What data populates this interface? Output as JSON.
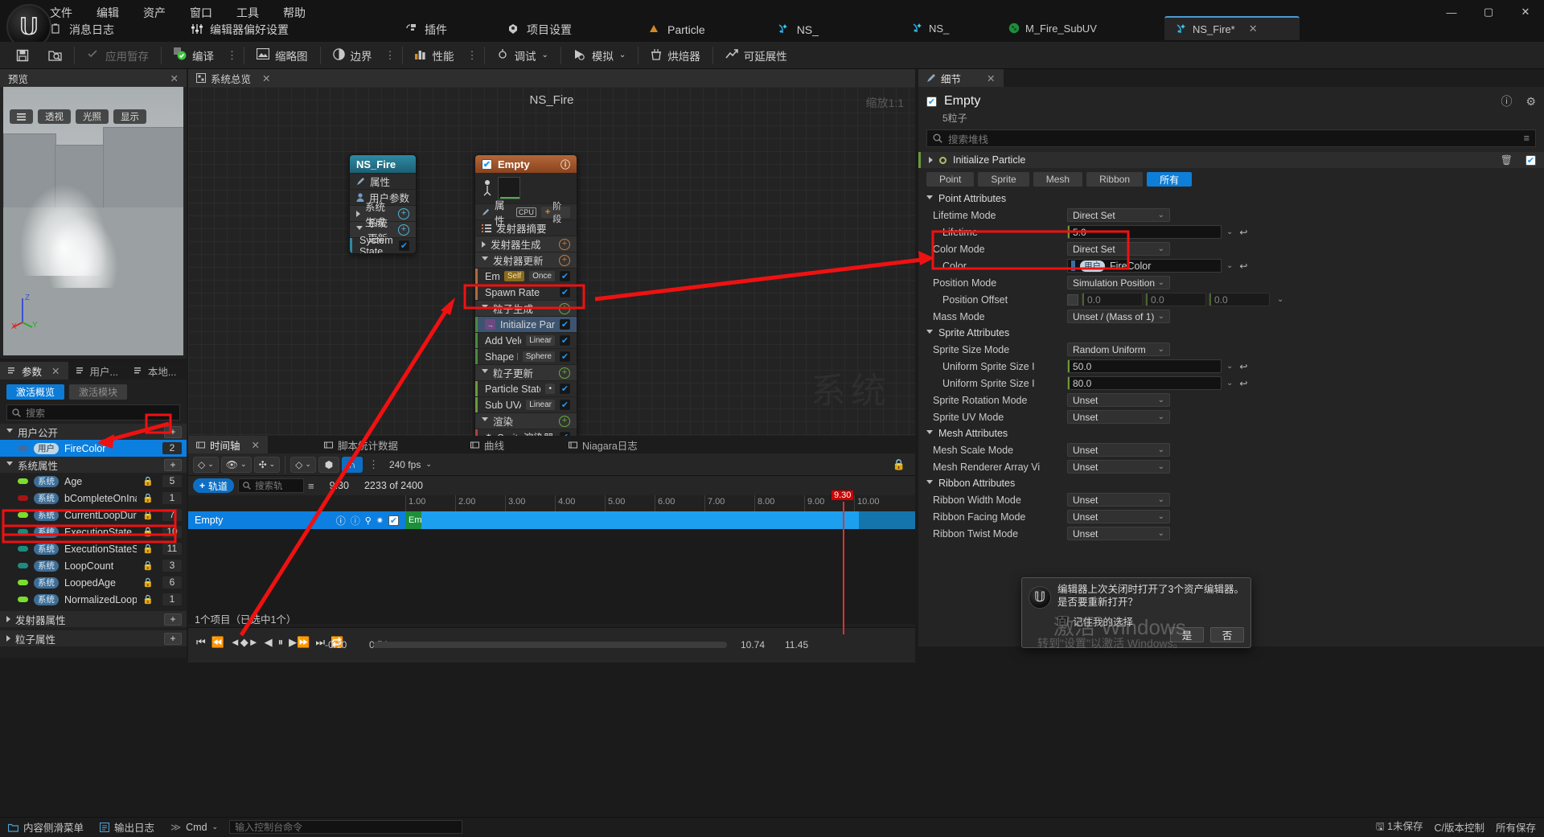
{
  "menu": {
    "items": [
      "文件",
      "编辑",
      "资产",
      "窗口",
      "工具",
      "帮助"
    ],
    "shortcuts": [
      {
        "label": "消息日志",
        "icon": "log-icon"
      },
      {
        "label": "编辑器偏好设置",
        "icon": "sliders-icon"
      },
      {
        "label": "插件",
        "icon": "plug-icon"
      },
      {
        "label": "项目设置",
        "icon": "settings-icon"
      },
      {
        "label": "Particle",
        "icon": "particle-icon"
      },
      {
        "label": "NS_",
        "icon": "niagara-icon"
      }
    ],
    "window_controls": {
      "minimize": "—",
      "maximize": "▢",
      "close": "✕"
    }
  },
  "tabs": [
    {
      "label": "NS_",
      "active": false,
      "icon": "niagara-icon"
    },
    {
      "label": "M_Fire_SubUV",
      "active": false,
      "icon": "material-icon"
    },
    {
      "label": "NS_Fire*",
      "active": true,
      "icon": "niagara-icon",
      "close": "✕"
    }
  ],
  "toolbar": {
    "save_icon": "save-icon",
    "browse_icon": "browse-icon",
    "items": [
      {
        "label": "应用暂存",
        "icon": "apply-icon",
        "dim": true
      },
      {
        "label": "编译",
        "icon": "compile-icon",
        "dim": false,
        "dots": true
      },
      {
        "label": "缩略图",
        "icon": "thumbnail-icon",
        "dim": false
      },
      {
        "label": "边界",
        "icon": "bounds-icon",
        "dim": false,
        "dots": true
      },
      {
        "label": "性能",
        "icon": "performance-icon",
        "dim": false,
        "dots": true
      },
      {
        "label": "调试",
        "icon": "debug-icon",
        "dim": false,
        "caret": "⌄"
      },
      {
        "label": "模拟",
        "icon": "simulate-icon",
        "dim": false,
        "caret": "⌄"
      },
      {
        "label": "烘焙器",
        "icon": "baker-icon",
        "dim": false
      },
      {
        "label": "可延展性",
        "icon": "scalability-icon",
        "dim": false
      }
    ]
  },
  "preview": {
    "tab_label": "预览",
    "close": "✕",
    "menu_icon": "hamburger-icon",
    "chips": [
      "透视",
      "光照",
      "显示"
    ],
    "axis": {
      "z": "Z",
      "x": "X",
      "y": "Y"
    }
  },
  "parameters": {
    "tabs": [
      {
        "label": "参数",
        "icon": "params-icon",
        "active": true,
        "close": "✕"
      },
      {
        "label": "用户...",
        "icon": "user-icon",
        "active": false
      },
      {
        "label": "本地...",
        "icon": "local-icon",
        "active": false
      }
    ],
    "buttons": [
      {
        "label": "激活概览",
        "active": true
      },
      {
        "label": "激活模块",
        "active": false
      }
    ],
    "search_placeholder": "搜索",
    "groups": [
      {
        "name": "用户公开",
        "add_label": "+",
        "rows": [
          {
            "tag": "用户",
            "tag_kind": "user",
            "name": "FireColor",
            "value": "2",
            "dot": "#3a6ea5",
            "locked": false,
            "selected": true
          }
        ]
      },
      {
        "name": "系统属性",
        "add_label": "+",
        "rows": [
          {
            "tag": "系统",
            "tag_kind": "system",
            "name": "Age",
            "value": "5",
            "dot": "#7ade2e",
            "locked": true,
            "selected": false
          },
          {
            "tag": "系统",
            "tag_kind": "system",
            "name": "bCompleteOnInacti",
            "value": "1",
            "dot": "#a81414",
            "locked": true,
            "selected": false
          },
          {
            "tag": "系统",
            "tag_kind": "system",
            "name": "CurrentLoopDuratic",
            "value": "7",
            "dot": "#7ade2e",
            "locked": true,
            "selected": false
          },
          {
            "tag": "系统",
            "tag_kind": "system",
            "name": "ExecutionState",
            "value": "10",
            "dot": "#1d8b7e",
            "locked": true,
            "selected": false
          },
          {
            "tag": "系统",
            "tag_kind": "system",
            "name": "ExecutionStateSou",
            "value": "11",
            "dot": "#1d8b7e",
            "locked": true,
            "selected": false
          },
          {
            "tag": "系统",
            "tag_kind": "system",
            "name": "LoopCount",
            "value": "3",
            "dot": "#1d8b7e",
            "locked": true,
            "selected": false
          },
          {
            "tag": "系统",
            "tag_kind": "system",
            "name": "LoopedAge",
            "value": "6",
            "dot": "#7ade2e",
            "locked": true,
            "selected": false
          },
          {
            "tag": "系统",
            "tag_kind": "system",
            "name": "NormalizedLoopAg",
            "value": "1",
            "dot": "#7ade2e",
            "locked": true,
            "selected": false
          }
        ]
      }
    ],
    "footers": [
      {
        "name": "发射器属性",
        "add_label": "+"
      },
      {
        "name": "粒子属性",
        "add_label": "+"
      }
    ]
  },
  "graph": {
    "tab_label": "系统总览",
    "close": "✕",
    "title": "NS_Fire",
    "zoom_label": "缩放1:1",
    "watermark": "系统",
    "system_node": {
      "title": "NS_Fire",
      "rows": [
        {
          "label": "属性",
          "icon": "properties-icon",
          "kind": "plain"
        },
        {
          "label": "用户参数",
          "icon": "user-icon",
          "kind": "plain"
        },
        {
          "label": "系统生成",
          "kind": "header",
          "add": "+"
        },
        {
          "label": "系统更新",
          "kind": "header",
          "add": "+",
          "expanded": true
        },
        {
          "label": "System State",
          "kind": "item",
          "checked": true
        }
      ]
    },
    "emitter_node": {
      "title": "Empty",
      "checked": true,
      "info_icon": "info-icon",
      "properties_label": "属性",
      "cpu_label": "CPU",
      "stage_label": "阶段",
      "summary_label": "发射器摘要",
      "rows": [
        {
          "label": "发射器生成",
          "kind": "header",
          "add": "+"
        },
        {
          "label": "发射器更新",
          "kind": "header",
          "add": "+",
          "expanded": true
        },
        {
          "label": "Emitter State",
          "kind": "item",
          "pills": [
            "Self",
            "Once"
          ],
          "checked": true
        },
        {
          "label": "Spawn Rate",
          "kind": "item",
          "checked": true
        },
        {
          "label": "粒子生成",
          "kind": "header",
          "add": "+",
          "expanded": true
        },
        {
          "label": "Initialize Particle",
          "kind": "item",
          "checked": true,
          "selected": true,
          "icon": "module-icon"
        },
        {
          "label": "Add Velocity",
          "kind": "item",
          "pills": [
            "Linear"
          ],
          "checked": true
        },
        {
          "label": "Shape Location",
          "kind": "item",
          "pills": [
            "Sphere"
          ],
          "checked": true
        },
        {
          "label": "粒子更新",
          "kind": "header",
          "add": "+",
          "expanded": true
        },
        {
          "label": "Particle State",
          "kind": "item",
          "pills": [
            "•"
          ],
          "checked": true
        },
        {
          "label": "Sub UVAnimation",
          "kind": "item",
          "pills": [
            "Linear"
          ],
          "checked": true
        },
        {
          "label": "渲染",
          "kind": "header",
          "add": "+",
          "expanded": true
        },
        {
          "label": "Sprite渲染器",
          "kind": "item",
          "checked": true,
          "icon": "sprite-icon"
        }
      ],
      "collapse": "⌃"
    }
  },
  "details": {
    "tab_label": "细节",
    "close": "✕",
    "object_name": "Empty",
    "object_checked": true,
    "particle_count": "5粒子",
    "info_icon": "info-icon",
    "gear_icon": "gear-icon",
    "search_placeholder": "搜索堆栈",
    "filter_icon": "filter-icon",
    "module": {
      "name": "Initialize Particle",
      "delete_icon": "trash-icon",
      "enabled": true,
      "modes": [
        {
          "label": "Point",
          "active": false
        },
        {
          "label": "Sprite",
          "active": false
        },
        {
          "label": "Mesh",
          "active": false
        },
        {
          "label": "Ribbon",
          "active": false
        },
        {
          "label": "所有",
          "active": true
        }
      ]
    },
    "sections": [
      {
        "title": "Point Attributes",
        "rows": [
          {
            "label": "Lifetime Mode",
            "type": "select",
            "value": "Direct Set",
            "indent": 0
          },
          {
            "label": "Lifetime",
            "type": "number",
            "value": "5.0",
            "indent": 1,
            "chevron": true,
            "revert": true
          },
          {
            "label": "Color Mode",
            "type": "select",
            "value": "Direct Set",
            "indent": 0
          },
          {
            "label": "Color",
            "type": "color",
            "value": "FireColor",
            "tag": "用户",
            "indent": 1,
            "chevron": true,
            "revert": true
          },
          {
            "label": "Position Mode",
            "type": "select",
            "value": "Simulation Position",
            "indent": 0
          },
          {
            "label": "Position Offset",
            "type": "vector3",
            "value": [
              "0.0",
              "0.0",
              "0.0"
            ],
            "indent": 1,
            "chevron": true,
            "disabled": true
          },
          {
            "label": "Mass Mode",
            "type": "select",
            "value": "Unset / (Mass of 1)",
            "indent": 0
          }
        ]
      },
      {
        "title": "Sprite Attributes",
        "rows": [
          {
            "label": "Sprite Size Mode",
            "type": "select",
            "value": "Random Uniform",
            "indent": 0
          },
          {
            "label": "Uniform Sprite Size I",
            "type": "number",
            "value": "50.0",
            "indent": 1,
            "chevron": true,
            "revert": true
          },
          {
            "label": "Uniform Sprite Size I",
            "type": "number",
            "value": "80.0",
            "indent": 1,
            "chevron": true,
            "revert": true
          },
          {
            "label": "Sprite Rotation Mode",
            "type": "select",
            "value": "Unset",
            "indent": 0
          },
          {
            "label": "Sprite UV Mode",
            "type": "select",
            "value": "Unset",
            "indent": 0
          }
        ]
      },
      {
        "title": "Mesh Attributes",
        "rows": [
          {
            "label": "Mesh Scale Mode",
            "type": "select",
            "value": "Unset",
            "indent": 0
          },
          {
            "label": "Mesh Renderer Array Vi",
            "type": "select",
            "value": "Unset",
            "indent": 0
          }
        ]
      },
      {
        "title": "Ribbon Attributes",
        "rows": [
          {
            "label": "Ribbon Width Mode",
            "type": "select",
            "value": "Unset",
            "indent": 0
          },
          {
            "label": "Ribbon Facing Mode",
            "type": "select",
            "value": "Unset",
            "indent": 0
          },
          {
            "label": "Ribbon Twist Mode",
            "type": "select",
            "value": "Unset",
            "indent": 0
          }
        ]
      }
    ]
  },
  "timeline": {
    "tabs": [
      {
        "label": "时间轴",
        "active": true,
        "icon": "timeline-icon",
        "close": "✕"
      },
      {
        "label": "脚本统计数据",
        "active": false,
        "icon": "stats-icon"
      },
      {
        "label": "曲线",
        "active": false,
        "icon": "curve-icon"
      },
      {
        "label": "Niagara日志",
        "active": false,
        "icon": "log-icon"
      }
    ],
    "controls": {
      "fps": "240 fps",
      "lock_icon": "lock-icon",
      "add_track": "轨道",
      "search_placeholder": "搜索轨",
      "filter_icon": "filter-icon",
      "current_time": "9.30",
      "frame_counter": "2233 of 2400"
    },
    "ruler_labels": [
      "1.00",
      "2.00",
      "3.00",
      "4.00",
      "5.00",
      "6.00",
      "7.00",
      "8.00",
      "9.00",
      "10.00"
    ],
    "playhead_label": "9.30",
    "track": {
      "name": "Empty",
      "clip_label": "Emp",
      "checked": true
    },
    "item_count": "1个项目（已选中1个）",
    "range": {
      "start": "-0.10",
      "in": "0.54",
      "out": "10.74",
      "end": "11.45"
    }
  },
  "statusbar": {
    "left": [
      {
        "label": "内容侧滑菜单",
        "icon": "content-icon"
      },
      {
        "label": "输出日志",
        "icon": "output-icon"
      },
      {
        "label": "Cmd",
        "icon": "cmd-icon",
        "caret": "⌄"
      }
    ],
    "cmd_placeholder": "输入控制台命令",
    "right": [
      {
        "label": "1未保存",
        "icon": "unsaved-icon"
      },
      {
        "label": "C/版本控制",
        "icon": "vcs-icon"
      },
      {
        "label": "所有保存",
        "icon": "saved-icon"
      }
    ]
  },
  "popup": {
    "message": "编辑器上次关闭时打开了3个资产编辑器。是否要重新打开？",
    "checkbox_label": "记住我的选择",
    "yes": "是",
    "no": "否",
    "icon": "ue-icon"
  },
  "activation_watermark": {
    "line1": "激活 Windows",
    "line2": "转到\"设置\"以激活 Windows。"
  },
  "colors": {
    "accent_blue": "#0d7fe0",
    "emitter_orange": "#b3683a",
    "system_teal": "#2e8aa3",
    "highlight_red": "#ef1111",
    "selection_blue": "#0b7fe0"
  }
}
